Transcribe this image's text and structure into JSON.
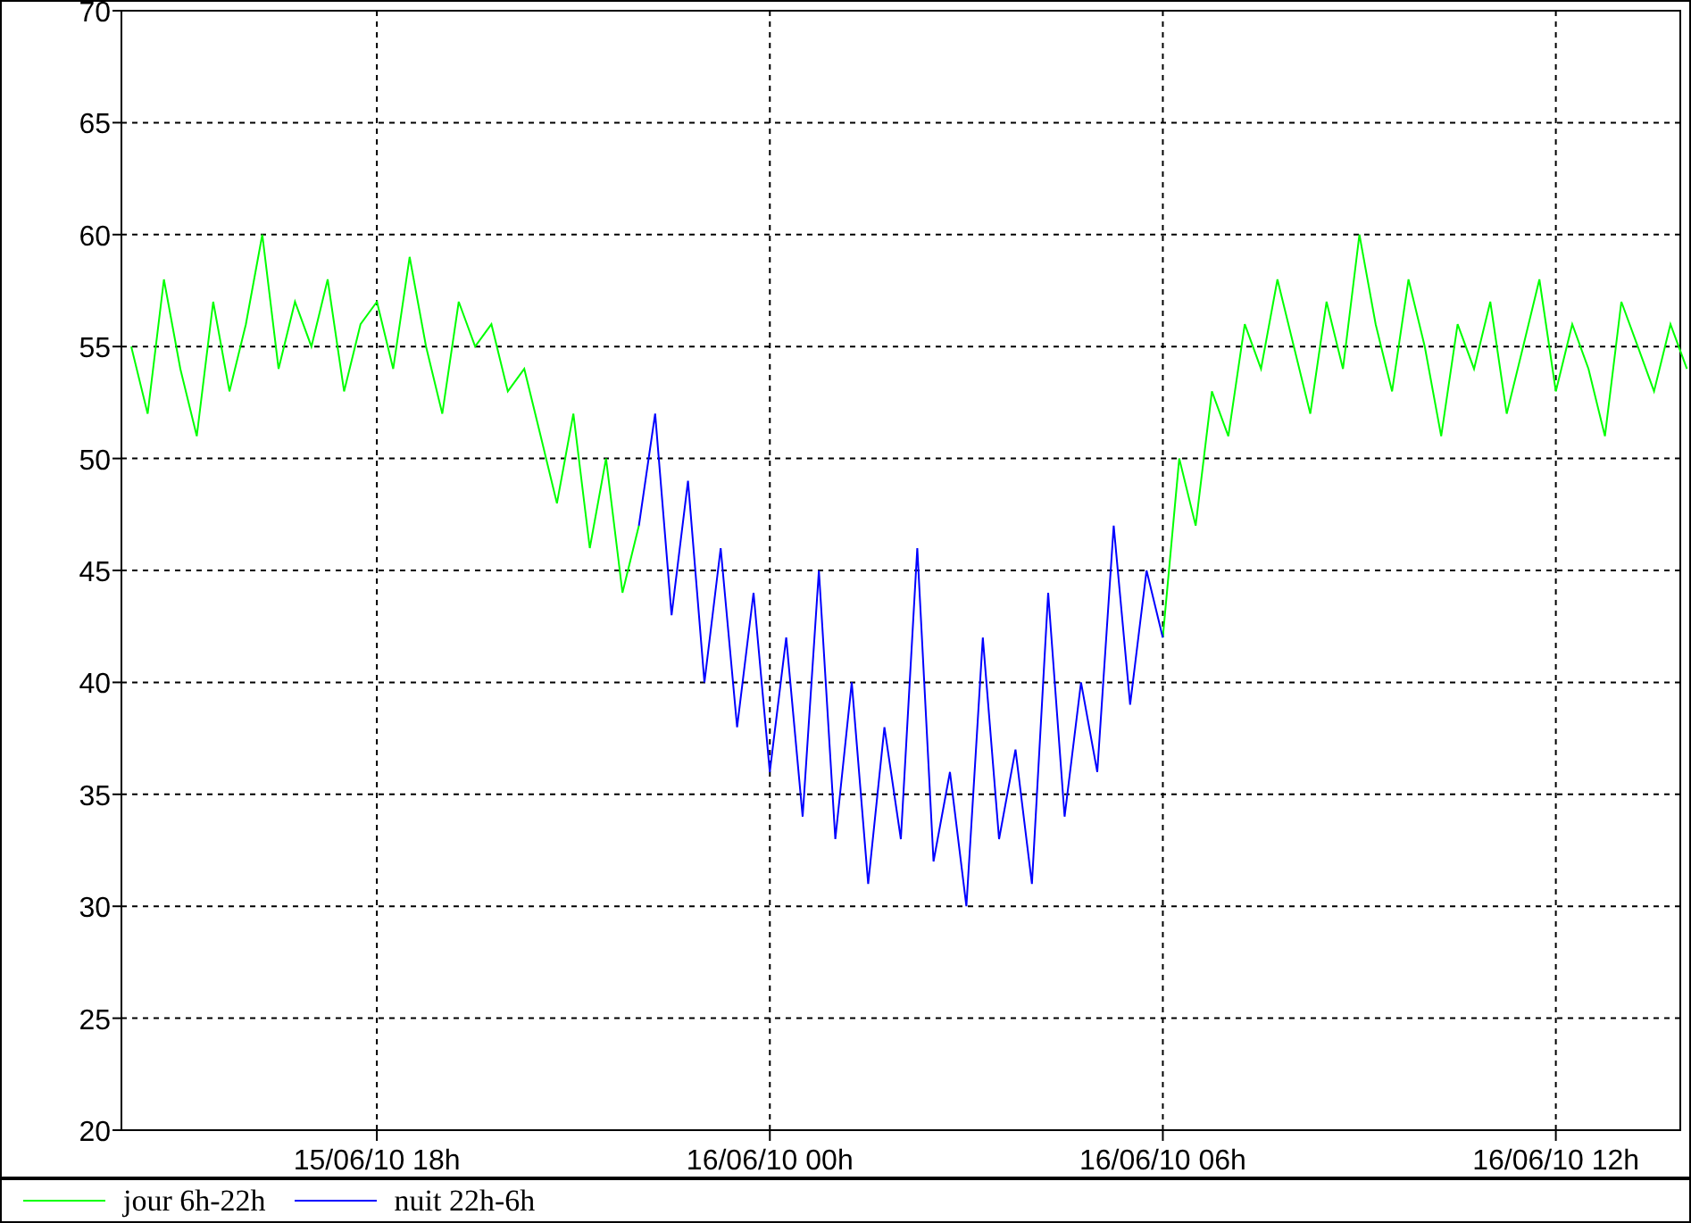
{
  "chart": {
    "chart_data": {
      "type": "line",
      "grid": true,
      "ylim": [
        20,
        70
      ],
      "yticks": [
        20,
        25,
        30,
        35,
        40,
        45,
        50,
        55,
        60,
        65,
        70
      ],
      "categories": [
        null,
        null,
        null,
        null,
        null,
        null,
        null,
        null,
        null,
        null,
        null,
        null,
        null,
        null,
        null,
        "15/06/10 18h",
        null,
        null,
        null,
        null,
        null,
        null,
        null,
        null,
        null,
        null,
        null,
        null,
        null,
        null,
        null,
        null,
        null,
        null,
        null,
        null,
        null,
        null,
        null,
        "16/06/10 00h",
        null,
        null,
        null,
        null,
        null,
        null,
        null,
        null,
        null,
        null,
        null,
        null,
        null,
        null,
        null,
        null,
        null,
        null,
        null,
        null,
        null,
        null,
        null,
        "16/06/10 06h",
        null,
        null,
        null,
        null,
        null,
        null,
        null,
        null,
        null,
        null,
        null,
        null,
        null,
        null,
        null,
        null,
        null,
        null,
        null,
        null,
        null,
        null,
        null,
        "16/06/10 12h",
        null,
        null,
        null,
        null,
        null,
        null,
        null,
        null
      ],
      "series": [
        {
          "name": "jour 6h-22h",
          "color": "#00ff00",
          "values": [
            55,
            52,
            58,
            54,
            51,
            57,
            53,
            56,
            60,
            54,
            57,
            55,
            58,
            53,
            56,
            57,
            54,
            59,
            55,
            52,
            57,
            55,
            56,
            53,
            54,
            51,
            48,
            52,
            46,
            50,
            44,
            47,
            null,
            null,
            null,
            null,
            null,
            null,
            null,
            null,
            null,
            null,
            null,
            null,
            null,
            null,
            null,
            null,
            null,
            null,
            null,
            null,
            null,
            null,
            null,
            null,
            null,
            null,
            null,
            null,
            null,
            null,
            null,
            42,
            50,
            47,
            53,
            51,
            56,
            54,
            58,
            55,
            52,
            57,
            54,
            60,
            56,
            53,
            58,
            55,
            51,
            56,
            54,
            57,
            52,
            55,
            58,
            53,
            56,
            54,
            51,
            57,
            55,
            53,
            56,
            54
          ]
        },
        {
          "name": "nuit 22h-6h",
          "color": "#0000ff",
          "values": [
            null,
            null,
            null,
            null,
            null,
            null,
            null,
            null,
            null,
            null,
            null,
            null,
            null,
            null,
            null,
            null,
            null,
            null,
            null,
            null,
            null,
            null,
            null,
            null,
            null,
            null,
            null,
            null,
            null,
            null,
            null,
            47,
            52,
            43,
            49,
            40,
            46,
            38,
            44,
            36,
            42,
            34,
            45,
            33,
            40,
            31,
            38,
            33,
            46,
            32,
            36,
            30,
            42,
            33,
            37,
            31,
            44,
            34,
            40,
            36,
            47,
            39,
            45,
            42,
            null,
            null,
            null,
            null,
            null,
            null,
            null,
            null,
            null,
            null,
            null,
            null,
            null,
            null,
            null,
            null,
            null,
            null,
            null,
            null,
            null,
            null,
            null,
            null,
            null,
            null,
            null,
            null,
            null,
            null,
            null,
            null
          ]
        }
      ]
    }
  }
}
